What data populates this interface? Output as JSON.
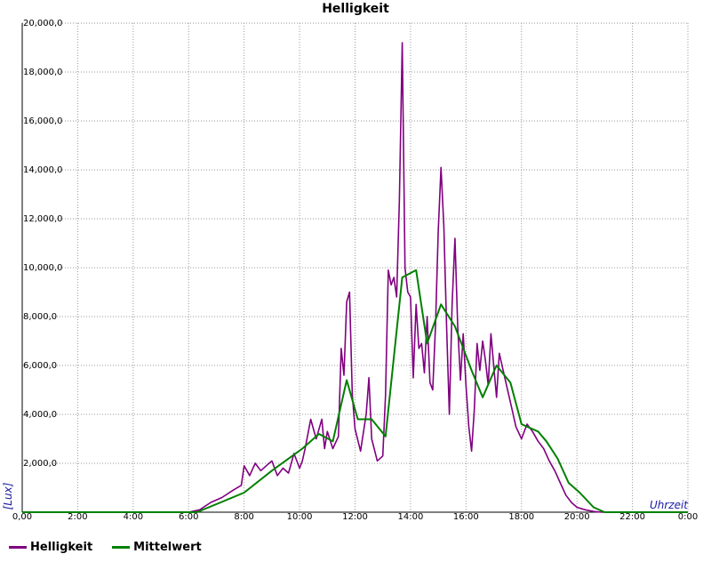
{
  "chart_data": {
    "type": "line",
    "title": "Helligkeit",
    "xlabel": "Uhrzeit",
    "ylabel": "[Lux]",
    "xlim": [
      0,
      24
    ],
    "ylim": [
      0,
      20000
    ],
    "grid": true,
    "legend_position": "bottom-left",
    "x_ticks": [
      {
        "v": 0,
        "label": "0,00"
      },
      {
        "v": 2,
        "label": "2:00"
      },
      {
        "v": 4,
        "label": "4:00"
      },
      {
        "v": 6,
        "label": "6:00"
      },
      {
        "v": 8,
        "label": "8:00"
      },
      {
        "v": 10,
        "label": "10:00"
      },
      {
        "v": 12,
        "label": "12:00"
      },
      {
        "v": 14,
        "label": "14:00"
      },
      {
        "v": 16,
        "label": "16:00"
      },
      {
        "v": 18,
        "label": "18:00"
      },
      {
        "v": 20,
        "label": "20:00"
      },
      {
        "v": 22,
        "label": "22:00"
      },
      {
        "v": 24,
        "label": "0:00"
      }
    ],
    "y_ticks": [
      {
        "v": 0,
        "label": "0,00"
      },
      {
        "v": 2000,
        "label": "2,000,0"
      },
      {
        "v": 4000,
        "label": "4,000,0"
      },
      {
        "v": 6000,
        "label": "6,000,0"
      },
      {
        "v": 8000,
        "label": "8,000,0"
      },
      {
        "v": 10000,
        "label": "10,000,0"
      },
      {
        "v": 12000,
        "label": "12,000,0"
      },
      {
        "v": 14000,
        "label": "14,000,0"
      },
      {
        "v": 16000,
        "label": "16,000,0"
      },
      {
        "v": 18000,
        "label": "18,000,0"
      },
      {
        "v": 20000,
        "label": "20,000,0"
      }
    ],
    "series": [
      {
        "name": "Helligkeit",
        "color": "#800080",
        "x": [
          0,
          6.0,
          6.4,
          6.8,
          7.2,
          7.6,
          7.9,
          8.0,
          8.2,
          8.4,
          8.6,
          8.8,
          9.0,
          9.2,
          9.4,
          9.6,
          9.8,
          10.0,
          10.1,
          10.2,
          10.4,
          10.6,
          10.8,
          10.9,
          11.0,
          11.2,
          11.4,
          11.5,
          11.6,
          11.7,
          11.8,
          11.9,
          12.0,
          12.2,
          12.4,
          12.5,
          12.6,
          12.8,
          13.0,
          13.1,
          13.2,
          13.3,
          13.4,
          13.5,
          13.6,
          13.7,
          13.8,
          13.9,
          14.0,
          14.1,
          14.2,
          14.3,
          14.4,
          14.5,
          14.6,
          14.7,
          14.8,
          14.9,
          15.0,
          15.1,
          15.2,
          15.3,
          15.4,
          15.5,
          15.6,
          15.7,
          15.8,
          15.9,
          16.0,
          16.1,
          16.2,
          16.3,
          16.4,
          16.5,
          16.6,
          16.7,
          16.8,
          16.9,
          17.0,
          17.1,
          17.2,
          17.4,
          17.6,
          17.8,
          18.0,
          18.2,
          18.4,
          18.6,
          18.8,
          19.0,
          19.2,
          19.4,
          19.6,
          19.8,
          20.0,
          20.3,
          20.6,
          20.9,
          21.2,
          24
        ],
        "y": [
          0,
          0,
          100,
          400,
          600,
          900,
          1100,
          1900,
          1500,
          2000,
          1700,
          1900,
          2100,
          1500,
          1800,
          1600,
          2400,
          1800,
          2100,
          2600,
          3800,
          3000,
          3800,
          2600,
          3300,
          2600,
          3100,
          6700,
          5600,
          8600,
          9000,
          4800,
          3400,
          2500,
          4000,
          5500,
          3000,
          2100,
          2300,
          4800,
          9900,
          9300,
          9600,
          8800,
          12800,
          19200,
          10000,
          9000,
          8800,
          5500,
          8500,
          6700,
          6900,
          5700,
          8000,
          5300,
          5000,
          7600,
          11500,
          14100,
          11700,
          7600,
          4000,
          8500,
          11200,
          7600,
          5400,
          7300,
          5200,
          3500,
          2500,
          4200,
          6900,
          5800,
          7000,
          6200,
          5200,
          7300,
          6000,
          4700,
          6500,
          5500,
          4500,
          3500,
          3000,
          3600,
          3300,
          2900,
          2600,
          2100,
          1700,
          1200,
          700,
          400,
          200,
          100,
          30,
          0,
          0,
          0
        ]
      },
      {
        "name": "Mittelwert",
        "color": "#008000",
        "x": [
          0,
          6.3,
          8.0,
          9.0,
          10.1,
          10.7,
          11.2,
          11.7,
          12.1,
          12.6,
          13.1,
          13.7,
          14.2,
          14.6,
          15.1,
          15.6,
          16.2,
          16.6,
          17.1,
          17.6,
          18.0,
          18.6,
          18.9,
          19.3,
          19.7,
          20.1,
          20.6,
          21.0,
          24
        ],
        "y": [
          0,
          0,
          800,
          1700,
          2600,
          3200,
          2900,
          5400,
          3800,
          3800,
          3100,
          9600,
          9900,
          6900,
          8500,
          7600,
          5800,
          4700,
          6000,
          5300,
          3600,
          3300,
          2900,
          2200,
          1200,
          800,
          200,
          0,
          0
        ]
      }
    ]
  }
}
